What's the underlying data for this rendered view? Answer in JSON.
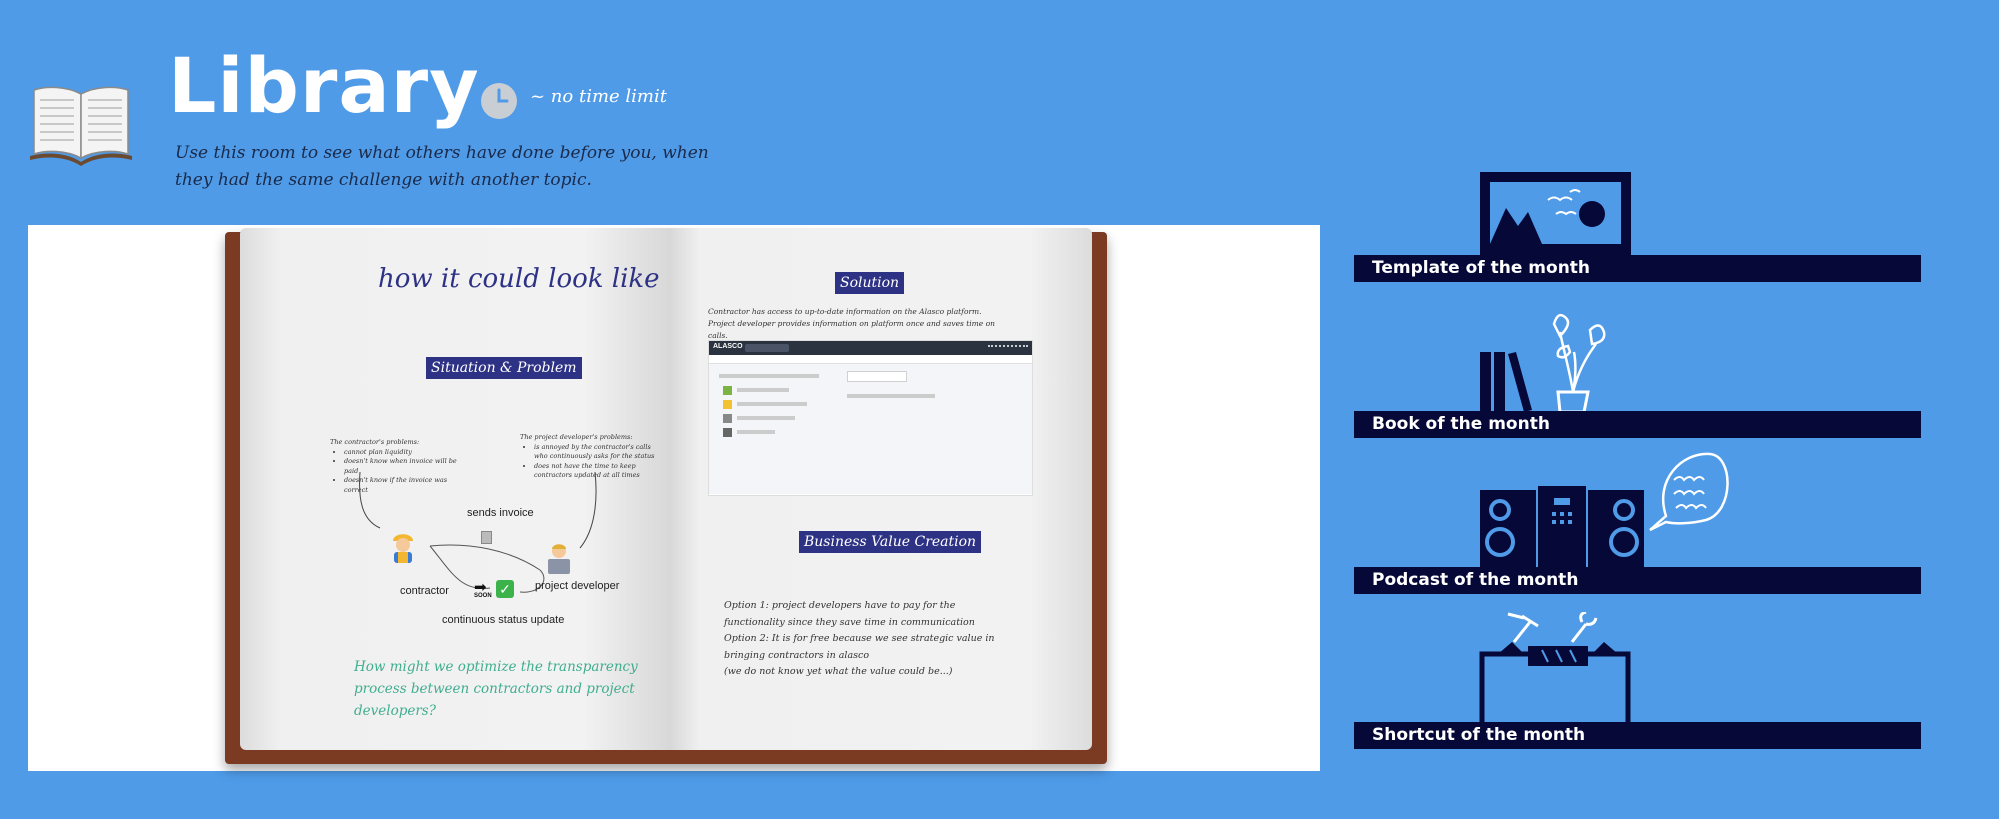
{
  "header": {
    "title": "Library",
    "time_note": "~ no time limit",
    "subtitle": "Use this room to see what others have done before you, when they had the same challenge with another topic."
  },
  "book": {
    "left_page": {
      "heading": "how it could look like",
      "section_tag": "Situation & Problem",
      "contractor_problems": {
        "title": "The contractor's problems:",
        "items": [
          "cannot plan liquidity",
          "doesn't know when invoice will be paid",
          "doesn't know if the invoice was correct"
        ]
      },
      "developer_problems": {
        "title": "The project developer's problems:",
        "items": [
          "is annoyed by the contractor's calls who continuously asks for the status",
          "does not have the time to keep contractors updated at all times"
        ]
      },
      "diagram": {
        "sends_invoice": "sends invoice",
        "contractor": "contractor",
        "project_developer": "project developer",
        "soon": "SOON",
        "continuous_update": "continuous status update"
      },
      "question": "How might we optimize the transparency process between contractors and project developers?"
    },
    "right_page": {
      "solution_tag": "Solution",
      "solution_text": "Contractor has access to up-to-date information on the Alasco platform. Project developer provides information on platform once and saves time on calls.",
      "screenshot_brand": "ALASCO",
      "business_tag": "Business Value Creation",
      "options": [
        "Option 1: project developers have to pay for the",
        "functionality since they save time in communication",
        "Option 2: It is for free because we see strategic value in",
        "bringing contractors in alasco",
        "(we do not know yet what the value could be...)"
      ]
    }
  },
  "shelves": [
    {
      "label": "Template of the month",
      "icon": "framed-picture-icon"
    },
    {
      "label": "Book of the month",
      "icon": "books-and-plant-icon"
    },
    {
      "label": "Podcast of the month",
      "icon": "speakers-and-speech-bubble-icon"
    },
    {
      "label": "Shortcut of the month",
      "icon": "toolbox-icon"
    }
  ],
  "colors": {
    "background": "#4f9be8",
    "shelf": "#060838",
    "tag": "#2d3284",
    "question_text": "#3fae8e"
  }
}
